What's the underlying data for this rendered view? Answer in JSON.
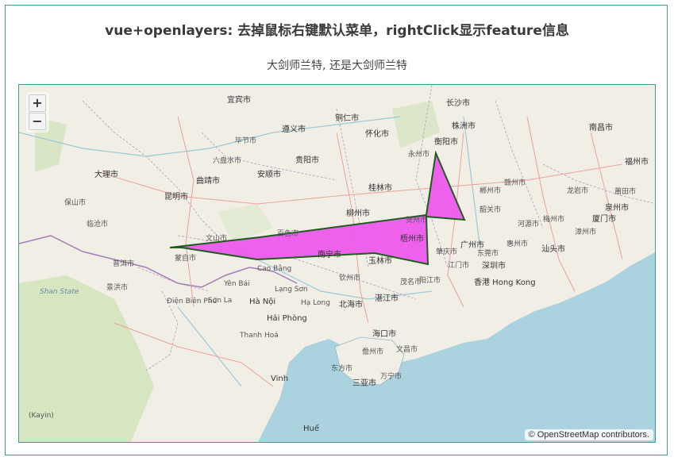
{
  "page": {
    "title": "vue+openlayers: 去掉鼠标右键默认菜单，rightClick显示feature信息",
    "subtitle": "大剑师兰特, 还是大剑师兰特"
  },
  "map": {
    "zoom_in_label": "+",
    "zoom_out_label": "−",
    "attribution": "© OpenStreetMap contributors.",
    "feature_fill": "#ee55ee",
    "feature_stroke": "#1e5c1e",
    "labels": {
      "yibin": "宜宾市",
      "zunyi": "遵义市",
      "tongren": "铜仁市",
      "huaihua": "怀化市",
      "changsha": "长沙市",
      "zhuzhou": "株洲市",
      "hengyang": "衡阳市",
      "nanchang": "南昌市",
      "dali": "大理市",
      "kunming": "昆明市",
      "qujing": "曲靖市",
      "anshun": "安顺市",
      "guiyang": "贵阳市",
      "liuzhou": "柳州市",
      "guilin": "桂林市",
      "wuzhou": "梧州市",
      "nanning": "南宁市",
      "yulin": "玉林市",
      "guangzhou": "广州市",
      "shenzhen": "深圳市",
      "hongkong": "香港 Hong Kong",
      "shantou": "汕头市",
      "fuzhou": "福州市",
      "xiamen": "厦门市",
      "quanzhou": "泉州市",
      "hanoi": "Hà Nội",
      "haiphong": "Hải Phòng",
      "haikou": "海口市",
      "sanya": "三亚市",
      "zhanjiang": "湛江市",
      "beihai": "北海市",
      "vinh": "Vinh",
      "hue": "Huế",
      "cao_bang": "Cao Bằng",
      "lang_son": "Lạng Sơn",
      "shan_state": "Shan State",
      "wenshan": "文山市",
      "mengzi": "蒙自市",
      "baise": "百色市",
      "qinzhou": "钦州市",
      "maoming": "茂名市",
      "zhaoqing": "肇庆市",
      "jiangmen": "江门市",
      "shaoguan": "韶关市",
      "ganzhou": "赣州市",
      "longyan": "龙岩市",
      "putian": "莆田市",
      "jinghong": "景洪市",
      "puer": "普洱市",
      "lincang": "临沧市",
      "baoshan": "保山市",
      "thanh_hoa": "Thanh Hoá",
      "dien_bien": "Điện Biên Phủ",
      "yen_bai": "Yên Bái",
      "son_la": "Sơn La",
      "ha_long": "Hạ Long",
      "kayin": "(Kayin)",
      "liupanshui": "六盘水市",
      "bijie": "毕节市",
      "chenzhou": "郴州市",
      "yongzhou": "永州市",
      "hezhou": "贺州市",
      "yangjiang": "阳江市",
      "dongguan": "东莞市",
      "huizhou": "惠州市",
      "heyuan": "河源市",
      "meizhou": "梅州市",
      "zhangzhou": "漳州市",
      "danzhou": "儋州市",
      "dongfang": "东方市",
      "wenchang": "文昌市",
      "wanning": "万宁市"
    }
  }
}
